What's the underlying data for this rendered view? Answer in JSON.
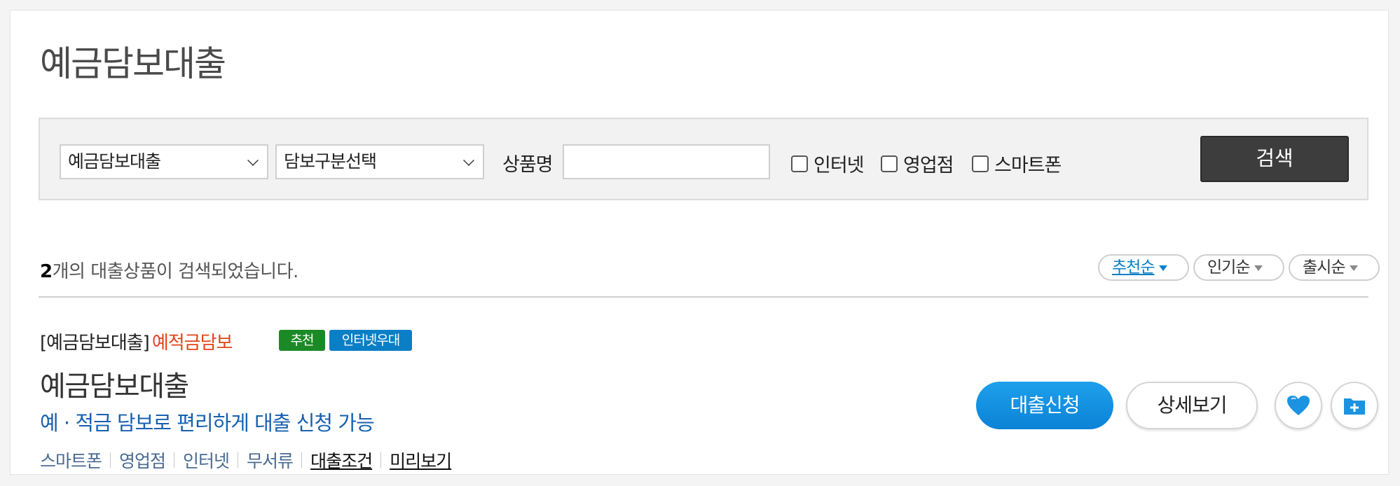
{
  "page": {
    "title": "예금담보대출"
  },
  "search": {
    "select1": "예금담보대출",
    "select2": "담보구분선택",
    "name_label": "상품명",
    "name_value": "",
    "checkboxes": [
      "인터넷",
      "영업점",
      "스마트폰"
    ],
    "button": "검색"
  },
  "result": {
    "count": "2",
    "text": "개의 대출상품이 검색되었습니다."
  },
  "sort": [
    {
      "label": "추천순",
      "active": true
    },
    {
      "label": "인기순",
      "active": false
    },
    {
      "label": "출시순",
      "active": false
    }
  ],
  "product": {
    "category": "[예금담보대출]",
    "subcategory": "예적금담보",
    "badges": [
      "추천",
      "인터넷우대"
    ],
    "name": "예금담보대출",
    "description": "예 · 적금 담보로 편리하게 대출 신청 가능",
    "channels": [
      "스마트폰",
      "영업점",
      "인터넷",
      "무서류"
    ],
    "links": [
      "대출조건",
      "미리보기"
    ],
    "apply_button": "대출신청",
    "detail_button": "상세보기"
  },
  "colors": {
    "accent_blue": "#0b82d6",
    "recommend_green": "#1b8a26",
    "highlight_red": "#e2431a",
    "search_button": "#3d3d3d"
  },
  "icons": {
    "favorite": "heart-icon",
    "folder": "folder-add-icon"
  }
}
